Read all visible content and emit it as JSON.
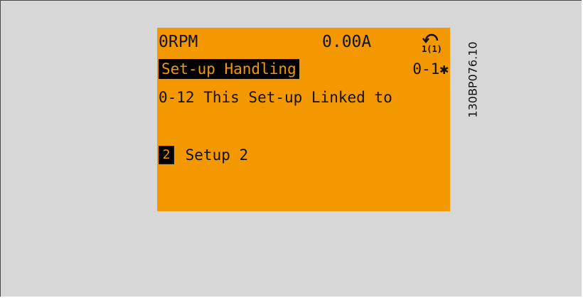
{
  "display": {
    "status": {
      "speed": "0RPM",
      "current": "0.00A",
      "setup_indicator": "1(1)",
      "setup_icon": "setup-cycle-icon"
    },
    "menu": {
      "title": "Set-up Handling",
      "code": "0-1✱"
    },
    "parameter": {
      "label": "0-12 This Set-up Linked to"
    },
    "value": {
      "index": "2",
      "label": "Setup 2"
    }
  },
  "figure_id": "130BP076.10",
  "colors": {
    "lcd_background": "#f39800",
    "lcd_text": "#111111",
    "highlight": "#000000",
    "frame_background": "#d7d7d7"
  }
}
